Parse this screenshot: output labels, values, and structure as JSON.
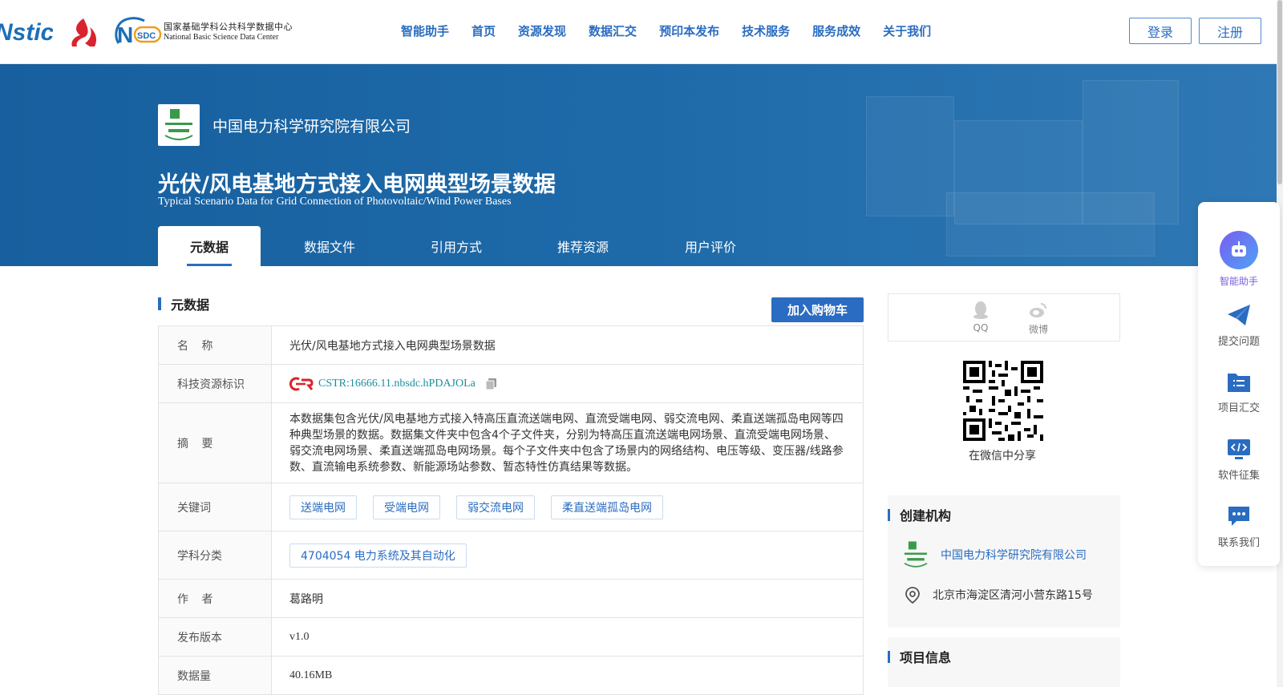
{
  "header": {
    "logo_istic_text": "Nstic",
    "nsdc_cn": "国家基础学科公共科学数据中心",
    "nsdc_en": "National Basic Science Data Center",
    "nsdc_mark": "NSDC",
    "nav": [
      "智能助手",
      "首页",
      "资源发现",
      "数据汇交",
      "预印本发布",
      "技术服务",
      "服务成效",
      "关于我们"
    ],
    "login": "登录",
    "register": "注册"
  },
  "hero": {
    "org_name": "中国电力科学研究院有限公司",
    "title_cn": "光伏/风电基地方式接入电网典型场景数据",
    "title_en": "Typical Scenario Data for Grid Connection of Photovoltaic/Wind Power Bases",
    "tabs": [
      "元数据",
      "数据文件",
      "引用方式",
      "推荐资源",
      "用户评价"
    ],
    "active_tab": "元数据"
  },
  "metadata": {
    "section_title": "元数据",
    "add_cart": "加入购物车",
    "rows": {
      "name": {
        "label": "名  称",
        "value": "光伏/风电基地方式接入电网典型场景数据"
      },
      "cstr": {
        "label": "科技资源标识",
        "value": "CSTR:16666.11.nbsdc.hPDAJOLa"
      },
      "abstract": {
        "label": "摘  要",
        "value": "本数据集包含光伏/风电基地方式接入特高压直流送端电网、直流受端电网、弱交流电网、柔直送端孤岛电网等四种典型场景的数据。数据集文件夹中包含4个子文件夹，分别为特高压直流送端电网场景、直流受端电网场景、弱交流电网场景、柔直送端孤岛电网场景。每个子文件夹中包含了场景内的网络结构、电压等级、变压器/线路参数、直流输电系统参数、新能源场站参数、暂态特性仿真结果等数据。"
      },
      "keywords": {
        "label": "关键词",
        "values": [
          "送端电网",
          "受端电网",
          "弱交流电网",
          "柔直送端孤岛电网"
        ]
      },
      "subject": {
        "label": "学科分类",
        "value": "4704054 电力系统及其自动化"
      },
      "author": {
        "label": "作  者",
        "value": "葛路明"
      },
      "version": {
        "label": "发布版本",
        "value": "v1.0"
      },
      "size": {
        "label": "数据量",
        "value": "40.16MB"
      }
    }
  },
  "sidebar": {
    "share_qq": "QQ",
    "share_weibo": "微博",
    "qr_caption": "在微信中分享",
    "creator_title": "创建机构",
    "creator_name": "中国电力科学研究院有限公司",
    "address": "北京市海淀区清河小营东路15号",
    "project_title": "项目信息"
  },
  "floatbar": {
    "items": [
      "智能助手",
      "提交问题",
      "项目汇交",
      "软件征集",
      "联系我们"
    ]
  },
  "colors": {
    "accent": "#2a6cc1",
    "hero_bg": "#1e6aa9"
  }
}
